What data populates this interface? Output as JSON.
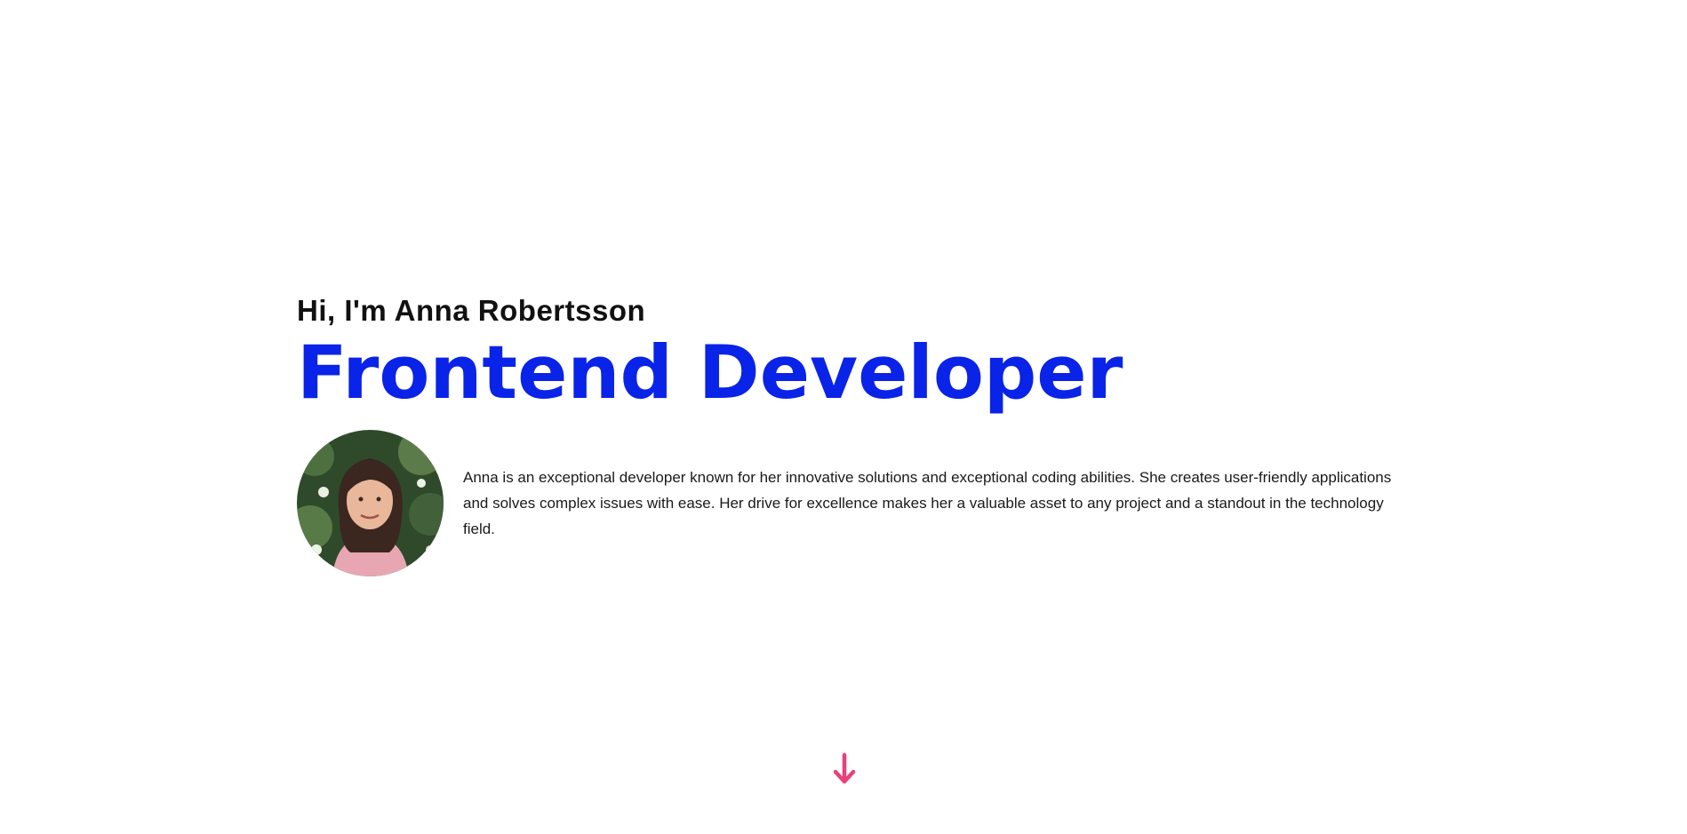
{
  "hero": {
    "greeting": "Hi, I'm Anna Robertsson",
    "role": "Frontend Developer",
    "bio": "Anna is an exceptional developer known for her innovative solutions and exceptional coding abilities. She creates user-friendly applications and solves complex issues with ease. Her drive for excellence makes her a valuable asset to any project and a standout in the technology field."
  },
  "icons": {
    "scroll": "arrow-down-icon"
  },
  "colors": {
    "accent": "#0a23e8",
    "arrow": "#e8417a",
    "text": "#111111"
  }
}
